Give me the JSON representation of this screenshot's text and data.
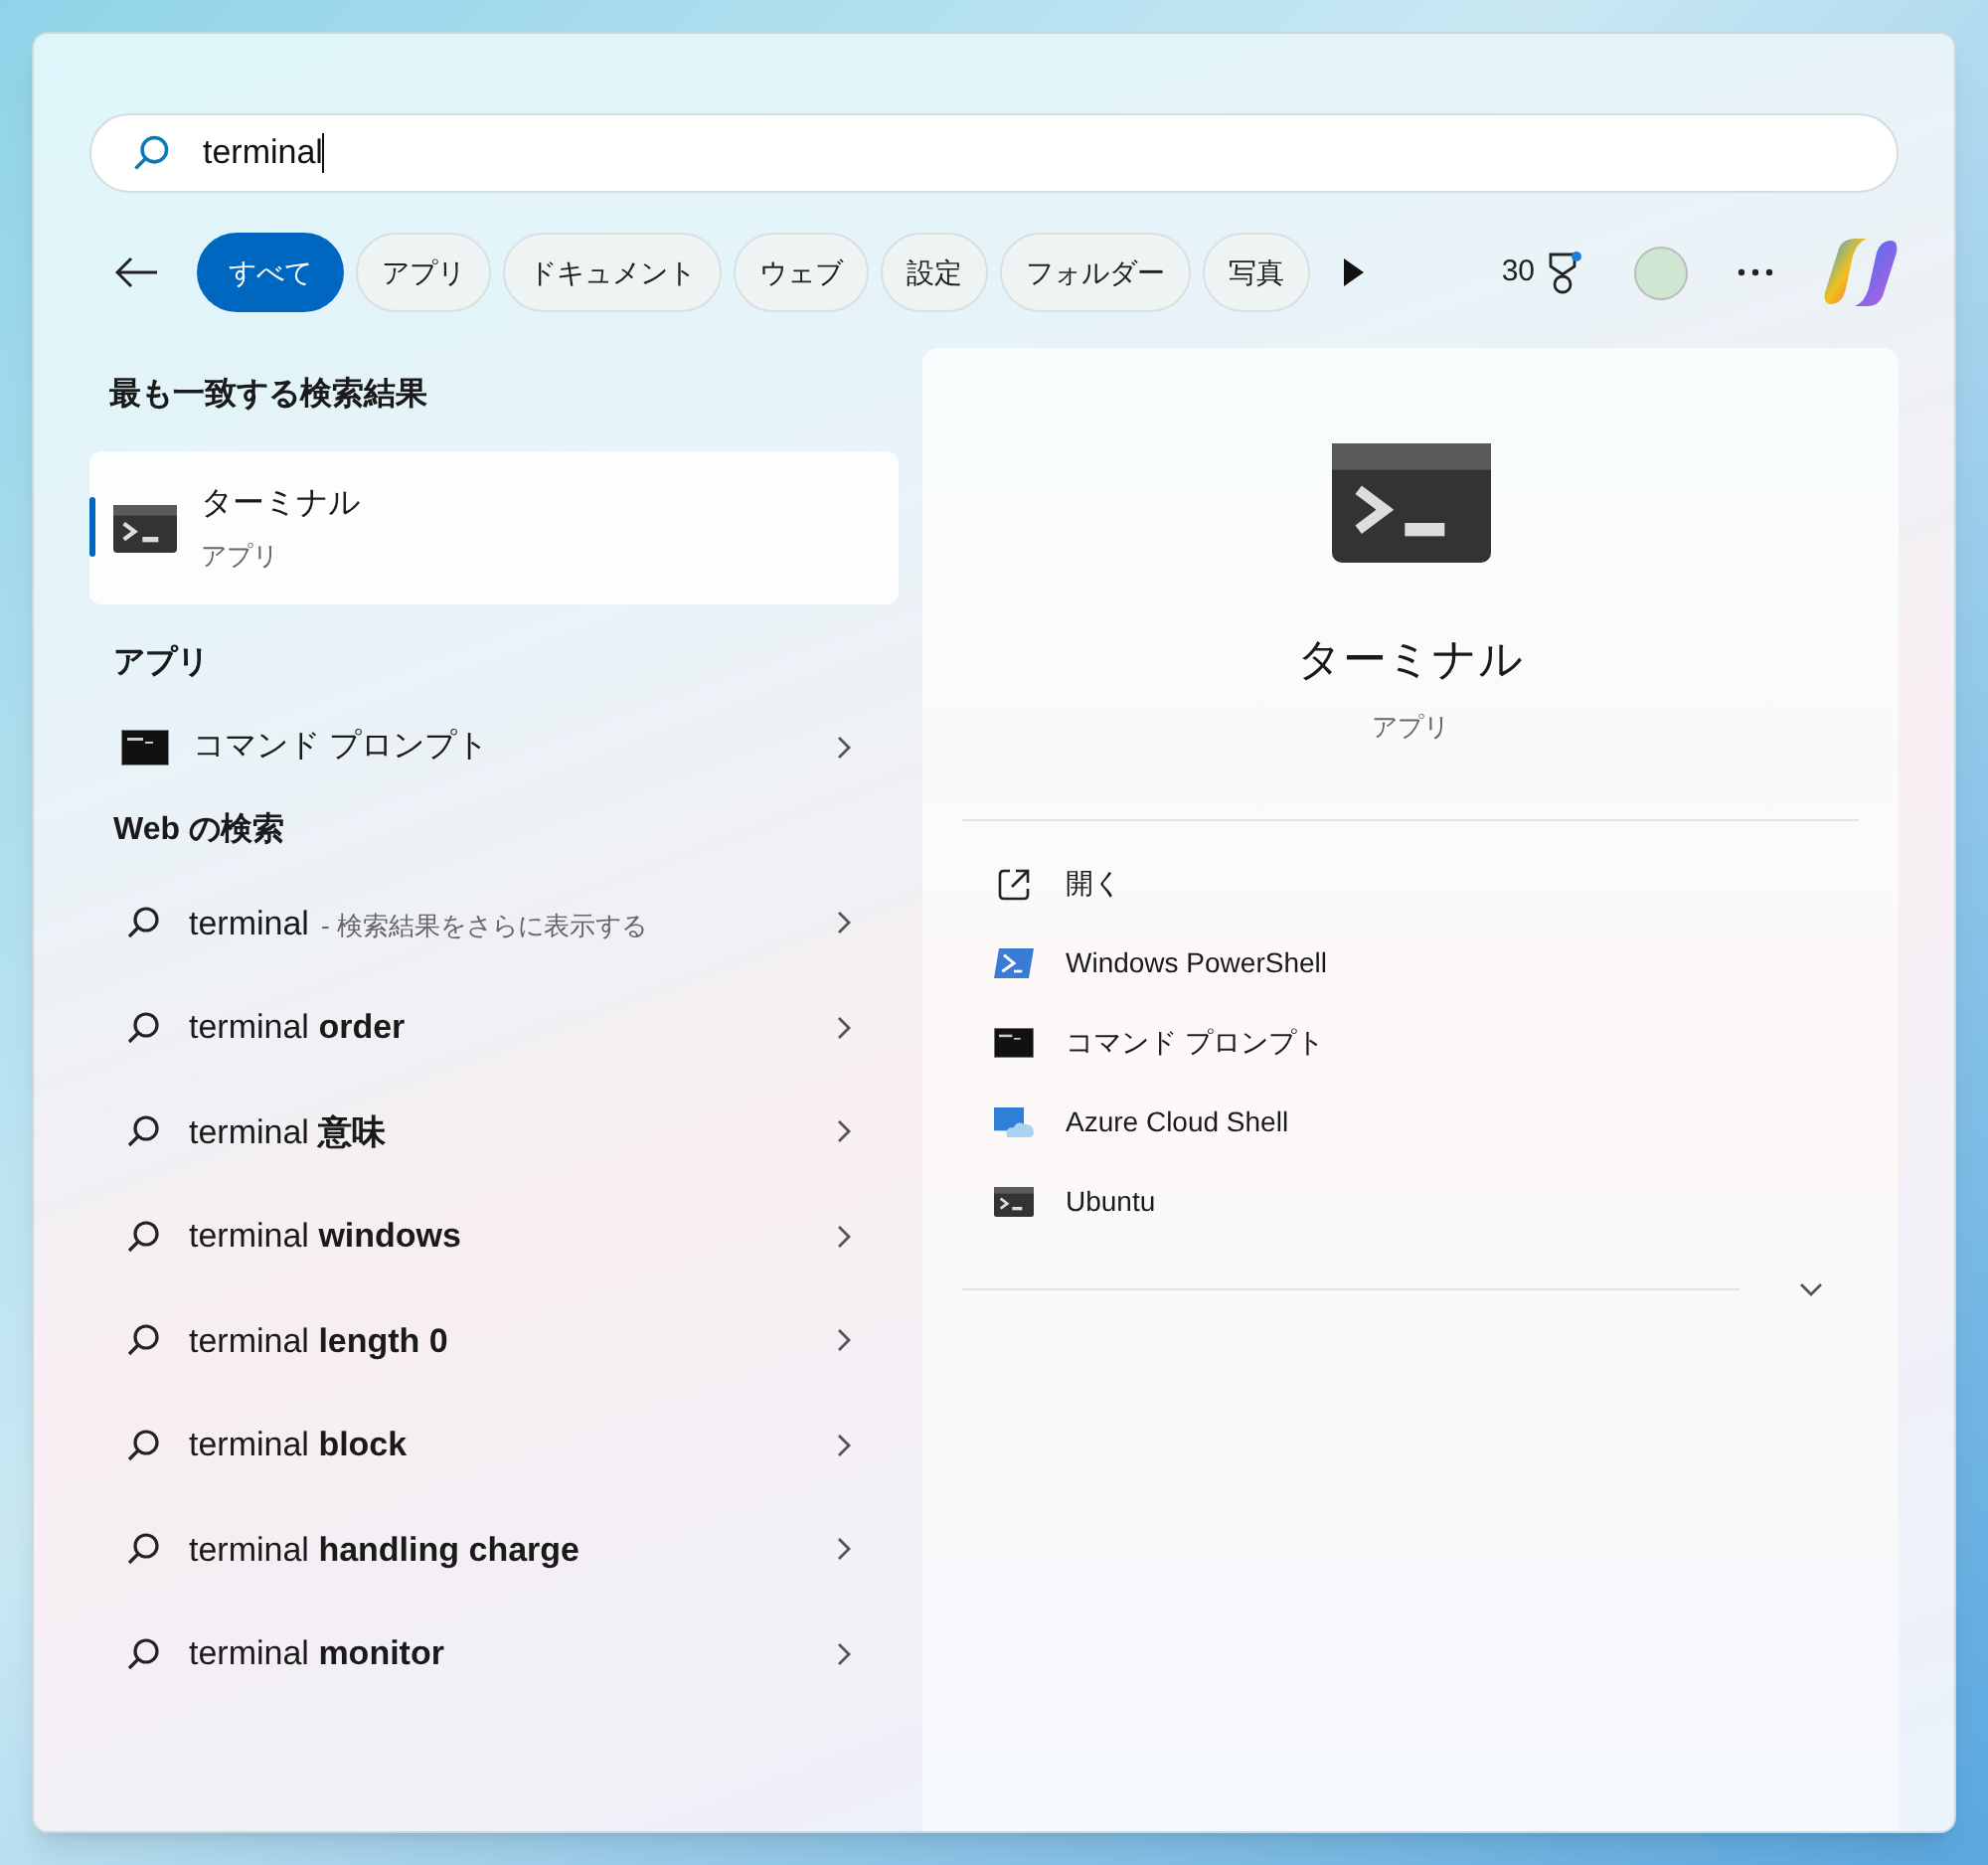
{
  "search": {
    "value": "terminal"
  },
  "filters": [
    {
      "label": "すべて",
      "selected": true
    },
    {
      "label": "アプリ",
      "selected": false
    },
    {
      "label": "ドキュメント",
      "selected": false
    },
    {
      "label": "ウェブ",
      "selected": false
    },
    {
      "label": "設定",
      "selected": false
    },
    {
      "label": "フォルダー",
      "selected": false
    },
    {
      "label": "写真",
      "selected": false
    }
  ],
  "points": "30",
  "best_match": {
    "heading": "最も一致する検索結果",
    "title": "ターミナル",
    "subtitle": "アプリ",
    "selected": true
  },
  "apps": {
    "heading": "アプリ",
    "items": [
      {
        "label": "コマンド プロンプト",
        "kind": "cmd"
      }
    ]
  },
  "web": {
    "heading": "Web の検索",
    "items": [
      {
        "text": "terminal",
        "note": "- 検索結果をさらに表示する"
      },
      {
        "text": "terminal **order**"
      },
      {
        "text": "terminal **意味**"
      },
      {
        "text": "terminal **windows**"
      },
      {
        "text": "terminal **length 0**"
      },
      {
        "text": "terminal **block**"
      },
      {
        "text": "terminal **handling charge**"
      },
      {
        "text": "terminal **monitor**"
      }
    ]
  },
  "detail": {
    "title": "ターミナル",
    "subtitle": "アプリ",
    "actions": [
      {
        "label": "開く",
        "kind": "open"
      },
      {
        "label": "Windows PowerShell",
        "kind": "powershell"
      },
      {
        "label": "コマンド プロンプト",
        "kind": "cmd"
      },
      {
        "label": "Azure Cloud Shell",
        "kind": "azure"
      },
      {
        "label": "Ubuntu",
        "kind": "ubuntu"
      }
    ]
  }
}
